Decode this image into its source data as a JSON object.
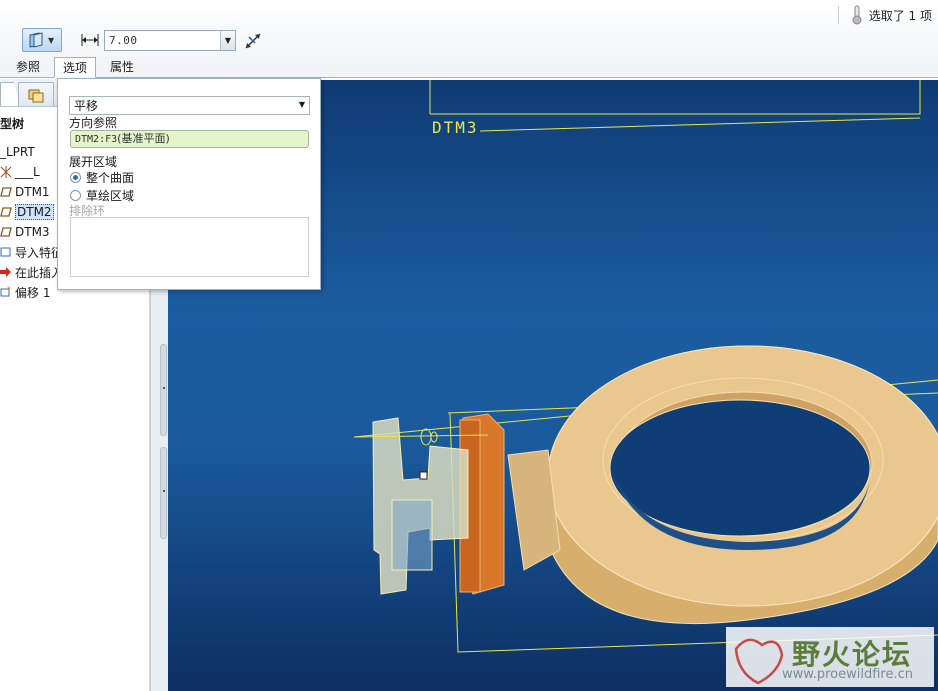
{
  "toolbar": {
    "selection_status": "选取了 1 项",
    "dimension_value": "7.00"
  },
  "tabs": [
    {
      "label": "参照",
      "active": false
    },
    {
      "label": "选项",
      "active": true
    },
    {
      "label": "属性",
      "active": false
    }
  ],
  "model_tree": {
    "header": "型树",
    "items": [
      {
        "label": "_LPRT",
        "icon": "part-icon"
      },
      {
        "label": "___L",
        "icon": "csys-icon"
      },
      {
        "label": "DTM1",
        "icon": "datum-plane-icon"
      },
      {
        "label": "DTM2",
        "icon": "datum-plane-icon",
        "selected": true
      },
      {
        "label": "DTM3",
        "icon": "datum-plane-icon"
      },
      {
        "label": "导入特征",
        "icon": "import-feature-icon"
      },
      {
        "label": "在此插入",
        "icon": "insert-here-arrow-icon"
      },
      {
        "label": "偏移 1",
        "icon": "offset-feature-icon"
      }
    ]
  },
  "options_panel": {
    "type_value": "平移",
    "direction_ref_label": "方向参照",
    "direction_ref_code": "DTM2:F3",
    "direction_ref_desc": "(基准平面)",
    "expand_area_label": "展开区域",
    "radio_whole_surface": "整个曲面",
    "radio_sketch_area": "草绘区域",
    "radio_selected": "whole_surface",
    "exclude_loop_label": "排除环"
  },
  "viewport": {
    "datum_label": "DTM3"
  },
  "watermark": {
    "name": "野火论坛",
    "url": "www.proewildfire.cn"
  },
  "colors": {
    "viewport_top": "#0f3b74",
    "viewport_mid": "#1b5da0",
    "datum_yellow": "#e6e84a",
    "part_tan": "#e8c48a",
    "feature_orange": "#d9772a"
  }
}
